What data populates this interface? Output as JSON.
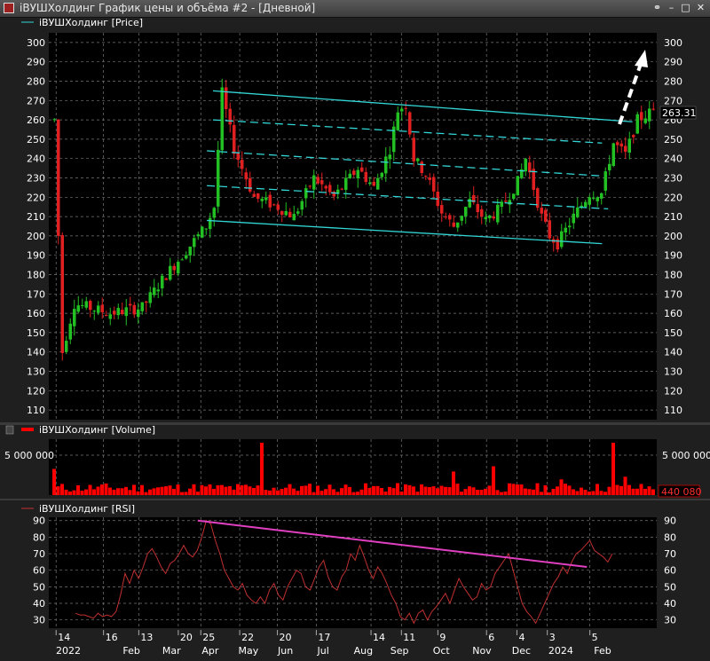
{
  "window": {
    "title": "iВУШХолдинг График цены и объёма #2 - [Дневной]"
  },
  "panels": {
    "price_legend": "iВУШХолдинг [Price]",
    "volume_legend": "iВУШХолдинг [Volume]",
    "rsi_legend": "iВУШХолдинг [RSI]"
  },
  "colors": {
    "background": "#1f1f1f",
    "plot_background": "#000000",
    "grid": "#777777",
    "candle_up": "#22c022",
    "candle_down": "#e02020",
    "channel": "#33d6d6",
    "volume": "#ff0000",
    "rsi_line": "#c03030",
    "rsi_trend": "#e040c0",
    "arrow": "#ffffff"
  },
  "chart_data": [
    {
      "type": "candlestick",
      "panel": "price",
      "series_name": "iВУШХолдинг [Price]",
      "y_ticks": [
        "300",
        "290",
        "280",
        "270",
        "260",
        "250",
        "240",
        "230",
        "220",
        "210",
        "200",
        "190",
        "180",
        "170",
        "160",
        "150",
        "140",
        "130",
        "120",
        "110"
      ],
      "ylim": [
        105,
        305
      ],
      "last_value": "263.31",
      "x_ticks": [
        "14",
        "16",
        "13",
        "20",
        "25",
        "22",
        "20",
        "17",
        "14",
        "11",
        "9",
        "6",
        "4",
        "3",
        "5"
      ],
      "x_month_labels": [
        "2022",
        "Feb",
        "Mar",
        "Apr",
        "May",
        "Jun",
        "Jul",
        "Aug",
        "Sep",
        "Oct",
        "Nov",
        "Dec",
        "2024",
        "Feb"
      ],
      "trend_points": [
        [
          0,
          260
        ],
        [
          2,
          140
        ],
        [
          5,
          165
        ],
        [
          14,
          160
        ],
        [
          22,
          163
        ],
        [
          28,
          180
        ],
        [
          34,
          195
        ],
        [
          38,
          205
        ],
        [
          40,
          215
        ],
        [
          42,
          274
        ],
        [
          45,
          245
        ],
        [
          50,
          220
        ],
        [
          56,
          215
        ],
        [
          60,
          210
        ],
        [
          65,
          230
        ],
        [
          70,
          220
        ],
        [
          76,
          235
        ],
        [
          80,
          225
        ],
        [
          84,
          245
        ],
        [
          86,
          265
        ],
        [
          88,
          268
        ],
        [
          90,
          240
        ],
        [
          93,
          232
        ],
        [
          97,
          212
        ],
        [
          100,
          205
        ],
        [
          104,
          218
        ],
        [
          108,
          208
        ],
        [
          112,
          215
        ],
        [
          116,
          228
        ],
        [
          118,
          240
        ],
        [
          120,
          225
        ],
        [
          122,
          210
        ],
        [
          124,
          200
        ],
        [
          126,
          196
        ],
        [
          130,
          210
        ],
        [
          134,
          222
        ],
        [
          137,
          222
        ],
        [
          140,
          248
        ],
        [
          143,
          242
        ],
        [
          146,
          260
        ],
        [
          150,
          265
        ]
      ],
      "channel_lines": [
        {
          "from": [
            0.27,
            275
          ],
          "to": [
            0.96,
            259
          ]
        },
        {
          "from": [
            0.27,
            260
          ],
          "to": [
            0.91,
            248
          ]
        },
        {
          "from": [
            0.26,
            244
          ],
          "to": [
            0.91,
            231
          ]
        },
        {
          "from": [
            0.26,
            226
          ],
          "to": [
            0.92,
            214
          ]
        },
        {
          "from": [
            0.26,
            208
          ],
          "to": [
            0.91,
            196
          ]
        }
      ],
      "annotation": "dashed up arrow"
    },
    {
      "type": "bar",
      "panel": "volume",
      "series_name": "iВУШХолдинг [Volume]",
      "y_ticks": [
        "5 000 000"
      ],
      "last_value": "440 080",
      "spikes": [
        [
          0,
          0.5
        ],
        [
          52,
          1.0
        ],
        [
          100,
          0.45
        ],
        [
          110,
          0.55
        ],
        [
          127,
          0.3
        ],
        [
          140,
          1.0
        ],
        [
          143,
          0.35
        ]
      ]
    },
    {
      "type": "line",
      "panel": "rsi",
      "series_name": "iВУШХолдинг [RSI]",
      "y_ticks": [
        "90",
        "80",
        "70",
        "60",
        "50",
        "40",
        "30"
      ],
      "ylim": [
        25,
        92
      ],
      "values": [
        34,
        33,
        33,
        32,
        31,
        34,
        32,
        33,
        32,
        35,
        45,
        58,
        52,
        60,
        55,
        62,
        70,
        73,
        68,
        62,
        58,
        64,
        66,
        70,
        75,
        70,
        68,
        72,
        80,
        90,
        88,
        78,
        70,
        60,
        55,
        50,
        48,
        52,
        45,
        42,
        40,
        44,
        40,
        48,
        52,
        45,
        42,
        50,
        55,
        60,
        58,
        50,
        48,
        55,
        62,
        66,
        56,
        50,
        48,
        56,
        60,
        70,
        66,
        75,
        68,
        60,
        55,
        62,
        58,
        52,
        45,
        40,
        32,
        30,
        34,
        28,
        34,
        36,
        30,
        35,
        38,
        42,
        46,
        40,
        48,
        55,
        50,
        46,
        42,
        44,
        52,
        48,
        50,
        58,
        62,
        66,
        70,
        60,
        50,
        40,
        35,
        32,
        28,
        34,
        40,
        46,
        52,
        56,
        62,
        58,
        65,
        70,
        72,
        75,
        78,
        72,
        70,
        68,
        65,
        70
      ]
    }
  ],
  "rsi_trendline": {
    "from": [
      0.245,
      90
    ],
    "to": [
      0.885,
      62
    ]
  }
}
